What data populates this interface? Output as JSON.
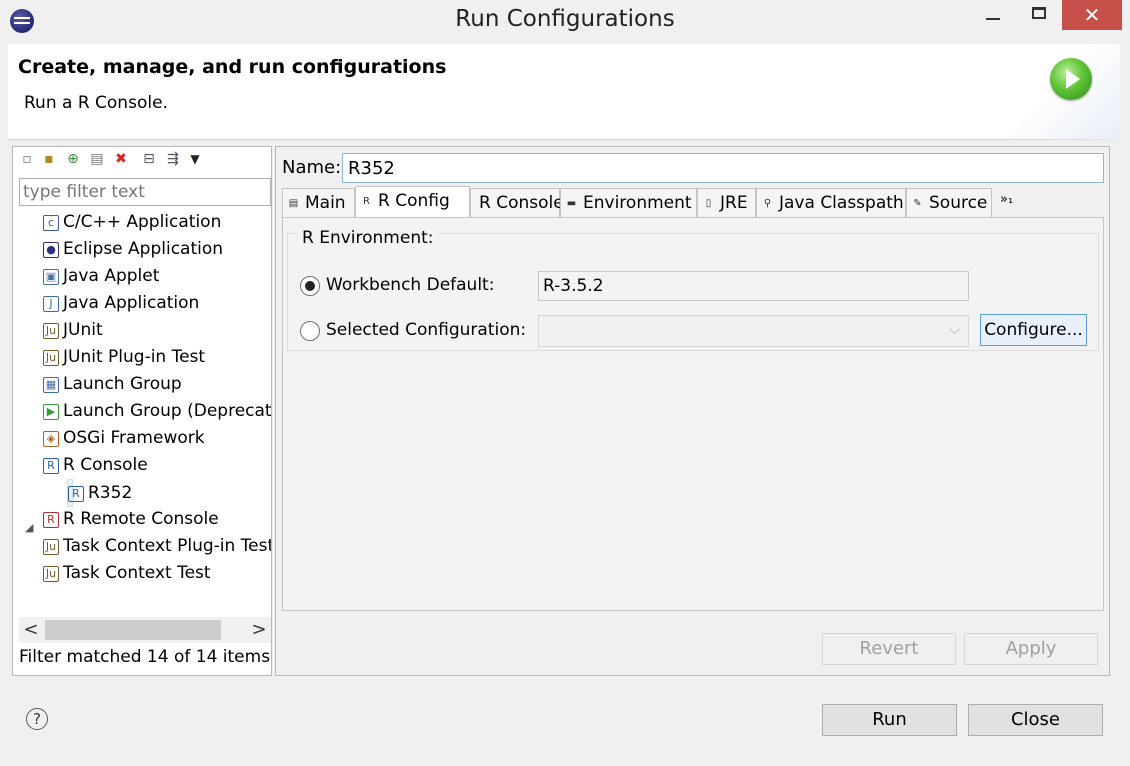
{
  "window": {
    "title": "Run Configurations",
    "close_glyph": "✕"
  },
  "banner": {
    "title": "Create, manage, and run configurations",
    "subtitle": "Run a R Console."
  },
  "left": {
    "toolbar_icons": [
      "new-config-icon",
      "new-prototype-icon",
      "export-icon",
      "duplicate-icon",
      "delete-icon",
      "collapse-all-icon",
      "filter-icon",
      "view-menu-icon"
    ],
    "filter_placeholder": "type filter text",
    "tree": [
      {
        "label": "C/C++ Application",
        "icon": "c-app-icon",
        "glyph": "c",
        "color": "#3b5aa0"
      },
      {
        "label": "Eclipse Application",
        "icon": "eclipse-icon",
        "glyph": "●",
        "color": "#2c2f7a"
      },
      {
        "label": "Java Applet",
        "icon": "applet-icon",
        "glyph": "▣",
        "color": "#4a6fa5"
      },
      {
        "label": "Java Application",
        "icon": "java-app-icon",
        "glyph": "J",
        "color": "#3b6ea5"
      },
      {
        "label": "JUnit",
        "icon": "junit-icon",
        "glyph": "Ju",
        "color": "#7a5a2c"
      },
      {
        "label": "JUnit Plug-in Test",
        "icon": "junit-plugin-icon",
        "glyph": "Ju",
        "color": "#7a5a2c"
      },
      {
        "label": "Launch Group",
        "icon": "launch-group-icon",
        "glyph": "▦",
        "color": "#3c6aa8"
      },
      {
        "label": "Launch Group (Deprecated)",
        "icon": "launch-group-deprecated-icon",
        "glyph": "▶",
        "color": "#3a9a3a"
      },
      {
        "label": "OSGi Framework",
        "icon": "osgi-icon",
        "glyph": "◈",
        "color": "#b06020"
      },
      {
        "label": "R Console",
        "icon": "r-console-icon",
        "glyph": "R",
        "color": "#2d5fa8"
      },
      {
        "label": "R352",
        "icon": "r-console-config-icon",
        "glyph": "R",
        "color": "#2d5fa8"
      },
      {
        "label": "R Remote Console",
        "icon": "r-remote-icon",
        "glyph": "R",
        "color": "#a83232"
      },
      {
        "label": "Task Context Plug-in Test",
        "icon": "task-plugin-icon",
        "glyph": "Ju",
        "color": "#7a5a2c"
      },
      {
        "label": "Task Context Test",
        "icon": "task-test-icon",
        "glyph": "Ju",
        "color": "#7a5a2c"
      }
    ],
    "scroll_left": "<",
    "scroll_right": ">",
    "filter_status": "Filter matched 14 of 14 items"
  },
  "right": {
    "name_label": "Name:",
    "name_value": "R352",
    "tabs": [
      {
        "label": "Main",
        "icon": "main-tab-icon",
        "glyph": "▤"
      },
      {
        "label": "R Config",
        "icon": "r-config-tab-icon",
        "glyph": "R",
        "active": true
      },
      {
        "label": "R Console",
        "icon": "r-console-tab-icon",
        "glyph": ""
      },
      {
        "label": "Environment",
        "icon": "environment-tab-icon",
        "glyph": "▬"
      },
      {
        "label": "JRE",
        "icon": "jre-tab-icon",
        "glyph": "▯"
      },
      {
        "label": "Java Classpath",
        "icon": "classpath-tab-icon",
        "glyph": "⚲"
      },
      {
        "label": "Source",
        "icon": "source-tab-icon",
        "glyph": "✎"
      }
    ],
    "tabs_more": "»₁",
    "env_group_label": "R Environment:",
    "workbench_default_label": "Workbench Default:",
    "workbench_default_value": "R-3.5.2",
    "selected_config_label": "Selected Configuration:",
    "selected_config_value": "",
    "configure_label": "Configure...",
    "revert_label": "Revert",
    "apply_label": "Apply"
  },
  "footer": {
    "help_glyph": "?",
    "run_label": "Run",
    "close_label": "Close"
  }
}
